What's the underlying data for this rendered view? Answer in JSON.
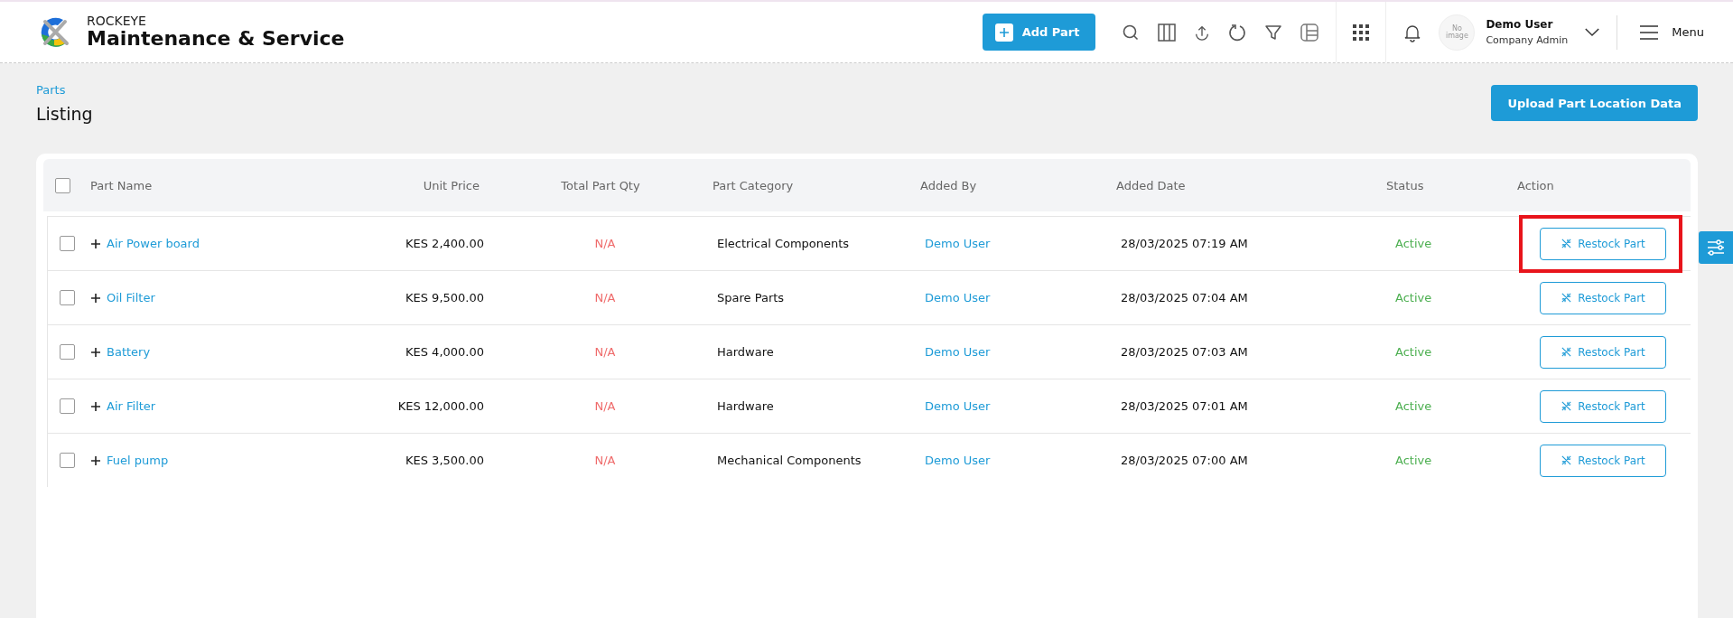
{
  "header": {
    "brand": "ROCKEYE",
    "app_title": "Maintenance & Service",
    "add_button": "Add Part",
    "avatar_text": "No image",
    "user_name": "Demo User",
    "user_role": "Company Admin",
    "menu_label": "Menu"
  },
  "breadcrumb": "Parts",
  "page_title": "Listing",
  "upload_button": "Upload Part Location Data",
  "table": {
    "select_all_checked": false,
    "columns": [
      "Part Name",
      "Unit Price",
      "Total Part Qty",
      "Part Category",
      "Added By",
      "Added Date",
      "Status",
      "Action"
    ],
    "rows": [
      {
        "checked": false,
        "name": "Air Power board",
        "unit_price": "KES 2,400.00",
        "qty": "N/A",
        "category": "Electrical Components",
        "added_by": "Demo User",
        "added_date": "28/03/2025 07:19 AM",
        "status": "Active",
        "action": "Restock Part",
        "highlighted": true
      },
      {
        "checked": false,
        "name": "Oil Filter",
        "unit_price": "KES 9,500.00",
        "qty": "N/A",
        "category": "Spare Parts",
        "added_by": "Demo User",
        "added_date": "28/03/2025 07:04 AM",
        "status": "Active",
        "action": "Restock Part",
        "highlighted": false
      },
      {
        "checked": false,
        "name": "Battery",
        "unit_price": "KES 4,000.00",
        "qty": "N/A",
        "category": "Hardware",
        "added_by": "Demo User",
        "added_date": "28/03/2025 07:03 AM",
        "status": "Active",
        "action": "Restock Part",
        "highlighted": false
      },
      {
        "checked": false,
        "name": "Air Filter",
        "unit_price": "KES 12,000.00",
        "qty": "N/A",
        "category": "Hardware",
        "added_by": "Demo User",
        "added_date": "28/03/2025 07:01 AM",
        "status": "Active",
        "action": "Restock Part",
        "highlighted": false
      },
      {
        "checked": false,
        "name": "Fuel pump",
        "unit_price": "KES 3,500.00",
        "qty": "N/A",
        "category": "Mechanical Components",
        "added_by": "Demo User",
        "added_date": "28/03/2025 07:00 AM",
        "status": "Active",
        "action": "Restock Part",
        "highlighted": false
      }
    ]
  }
}
